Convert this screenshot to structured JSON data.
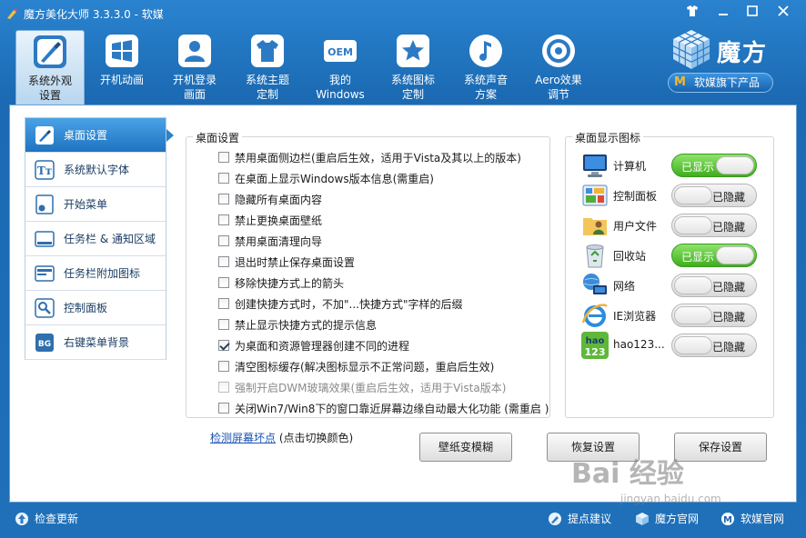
{
  "window": {
    "title": "魔方美化大师 3.3.3.0 - 软媒",
    "controls": [
      "skin-icon",
      "minimize-icon",
      "maximize-icon",
      "close-icon"
    ]
  },
  "toolbar": [
    {
      "label1": "系统外观",
      "label2": "设置",
      "icon": "palette-brush-icon",
      "active": true
    },
    {
      "label1": "开机动画",
      "label2": "",
      "icon": "windows-logo-icon"
    },
    {
      "label1": "开机登录",
      "label2": "画面",
      "icon": "user-login-icon"
    },
    {
      "label1": "系统主题",
      "label2": "定制",
      "icon": "tshirt-icon"
    },
    {
      "label1": "我的",
      "label2": "Windows",
      "icon": "oem-icon"
    },
    {
      "label1": "系统图标",
      "label2": "定制",
      "icon": "star-icon"
    },
    {
      "label1": "系统声音",
      "label2": "方案",
      "icon": "music-note-icon"
    },
    {
      "label1": "Aero效果",
      "label2": "调节",
      "icon": "aero-disc-icon"
    }
  ],
  "brand": {
    "name": "魔方",
    "sub": "软媒旗下产品",
    "badge": "M"
  },
  "sidebar": {
    "items": [
      {
        "label": "桌面设置",
        "icon": "desktop-brush-icon",
        "active": true
      },
      {
        "label": "系统默认字体",
        "icon": "font-icon"
      },
      {
        "label": "开始菜单",
        "icon": "start-menu-icon"
      },
      {
        "label": "任务栏 & 通知区域",
        "icon": "taskbar-icon"
      },
      {
        "label": "任务栏附加图标",
        "icon": "taskbar-addon-icon"
      },
      {
        "label": "控制面板",
        "icon": "control-panel-icon"
      },
      {
        "label": "右键菜单背景",
        "icon": "context-bg-icon"
      }
    ]
  },
  "desktop_settings": {
    "title": "桌面设置",
    "options": [
      {
        "label": "禁用桌面侧边栏(重启后生效，适用于Vista及其以上的版本)",
        "checked": false
      },
      {
        "label": "在桌面上显示Windows版本信息(需重启)",
        "checked": false
      },
      {
        "label": "隐藏所有桌面内容",
        "checked": false
      },
      {
        "label": "禁止更换桌面壁纸",
        "checked": false
      },
      {
        "label": "禁用桌面清理向导",
        "checked": false
      },
      {
        "label": "退出时禁止保存桌面设置",
        "checked": false
      },
      {
        "label": "移除快捷方式上的箭头",
        "checked": false
      },
      {
        "label": "创建快捷方式时，不加\"...快捷方式\"字样的后缀",
        "checked": false
      },
      {
        "label": "禁止显示快捷方式的提示信息",
        "checked": false
      },
      {
        "label": "为桌面和资源管理器创建不同的进程",
        "checked": true
      },
      {
        "label": "清空图标缓存(解决图标显示不正常问题，重启后生效)",
        "checked": false
      },
      {
        "label": "强制开启DWM玻璃效果(重启后生效，适用于Vista版本)",
        "checked": false,
        "disabled": true
      },
      {
        "label": "关闭Win7/Win8下的窗口靠近屏幕边缘自动最大化功能 (需重启 )",
        "checked": false
      }
    ]
  },
  "desktop_icons": {
    "title": "桌面显示图标",
    "on_text": "已显示",
    "off_text": "已隐藏",
    "items": [
      {
        "name": "计算机",
        "icon": "computer-icon",
        "shown": true
      },
      {
        "name": "控制面板",
        "icon": "control-panel-icon",
        "shown": false
      },
      {
        "name": "用户文件",
        "icon": "user-folder-icon",
        "shown": false
      },
      {
        "name": "回收站",
        "icon": "recycle-bin-icon",
        "shown": true
      },
      {
        "name": "网络",
        "icon": "network-icon",
        "shown": false
      },
      {
        "name": "IE浏览器",
        "icon": "ie-browser-icon",
        "shown": false
      },
      {
        "name": "hao123...",
        "icon": "hao123-icon",
        "shown": false
      }
    ]
  },
  "actions": {
    "detect_link": "检测屏幕坏点",
    "detect_hint": "(点击切换颜色)",
    "wallpaper_blur": "壁纸变模糊",
    "restore": "恢复设置",
    "save": "保存设置"
  },
  "status": {
    "check_update": "检查更新",
    "suggest": "提点建议",
    "mofang_site": "魔方官网",
    "ruanmei_site": "软媒官网"
  },
  "watermark": {
    "text": "Bai 经验",
    "url": "jingyan.baidu.com"
  }
}
